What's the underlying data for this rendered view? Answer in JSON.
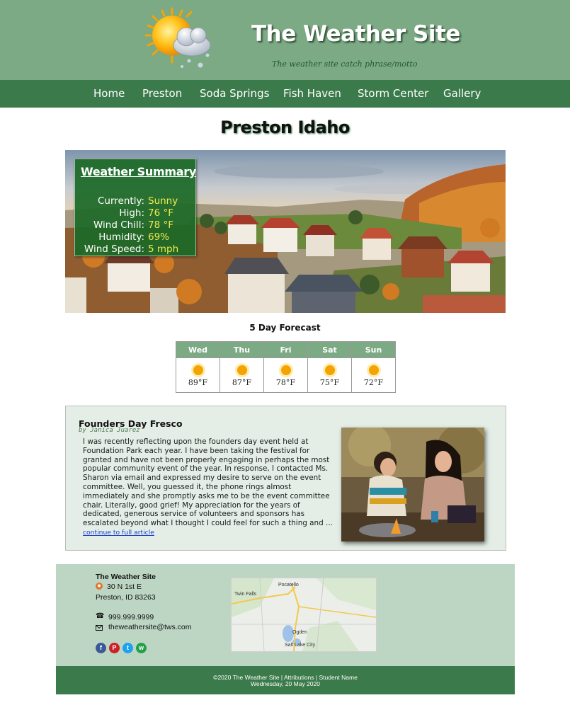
{
  "header": {
    "title": "The Weather Site",
    "motto": "The weather site catch phrase/motto",
    "logo_icon": "sun-cloud-snow-icon"
  },
  "nav": [
    "Home",
    "Preston",
    "Soda Springs",
    "Fish Haven",
    "Storm Center",
    "Gallery"
  ],
  "page_heading": "Preston Idaho",
  "summary": {
    "title": "Weather Summary",
    "rows": [
      {
        "label": "Currently:",
        "value": "Sunny"
      },
      {
        "label": "High:",
        "value": "76 °F"
      },
      {
        "label": "Wind Chill:",
        "value": "78 °F"
      },
      {
        "label": "Humidity:",
        "value": "69%"
      },
      {
        "label": "Wind Speed:",
        "value": "5 mph"
      }
    ]
  },
  "forecast": {
    "title": "5 Day Forecast",
    "days": [
      {
        "day": "Wed",
        "temp": "89°F",
        "icon": "sun-icon"
      },
      {
        "day": "Thu",
        "temp": "87°F",
        "icon": "sun-icon"
      },
      {
        "day": "Fri",
        "temp": "78°F",
        "icon": "sun-icon"
      },
      {
        "day": "Sat",
        "temp": "75°F",
        "icon": "sun-icon"
      },
      {
        "day": "Sun",
        "temp": "72°F",
        "icon": "sun-icon"
      }
    ]
  },
  "article": {
    "title": "Founders Day Fresco",
    "byline": "by Janica Juarez",
    "body": "I was recently reflecting upon the founders day event held at Foundation Park each year. I have been taking the festival for granted and have not been properly engaging in perhaps the most popular community event of the year. In response, I contacted Ms. Sharon via email and expressed my desire to serve on the event committee. Well, you guessed it, the phone rings almost immediately and she promptly asks me to be the event committee chair. Literally, good grief! My appreciation for the years of dedicated, generous service of volunteers and sponsors has escalated beyond what I thought I could feel for such a thing and ... ",
    "link": "continue to full article"
  },
  "footer": {
    "name": "The Weather Site",
    "street": "30 N 1st E",
    "city": "Preston, ID 83263",
    "phone": "999.999.9999",
    "email": "theweathersite@tws.com",
    "social": [
      {
        "icon": "facebook-icon",
        "glyph": "f",
        "color": "#3b5998"
      },
      {
        "icon": "pinterest-icon",
        "glyph": "P",
        "color": "#cb2027"
      },
      {
        "icon": "twitter-icon",
        "glyph": "t",
        "color": "#1da1f2"
      },
      {
        "icon": "whatsapp-icon",
        "glyph": "w",
        "color": "#25a04a"
      }
    ],
    "map_labels": {
      "pocatello": "Pocatello",
      "twin_falls": "Twin Falls",
      "ogden": "Ogden",
      "slc": "Salt Lake City"
    }
  },
  "copyright": {
    "line1": "©2020 The Weather Site | Attributions | Student Name",
    "line2": "Wednesday, 20 May 2020"
  },
  "colors": {
    "header_bg": "#7caa84",
    "nav_bg": "#3b7a4a",
    "summary_value": "#f2ea4a",
    "footer_bg": "#bdd6c3"
  }
}
